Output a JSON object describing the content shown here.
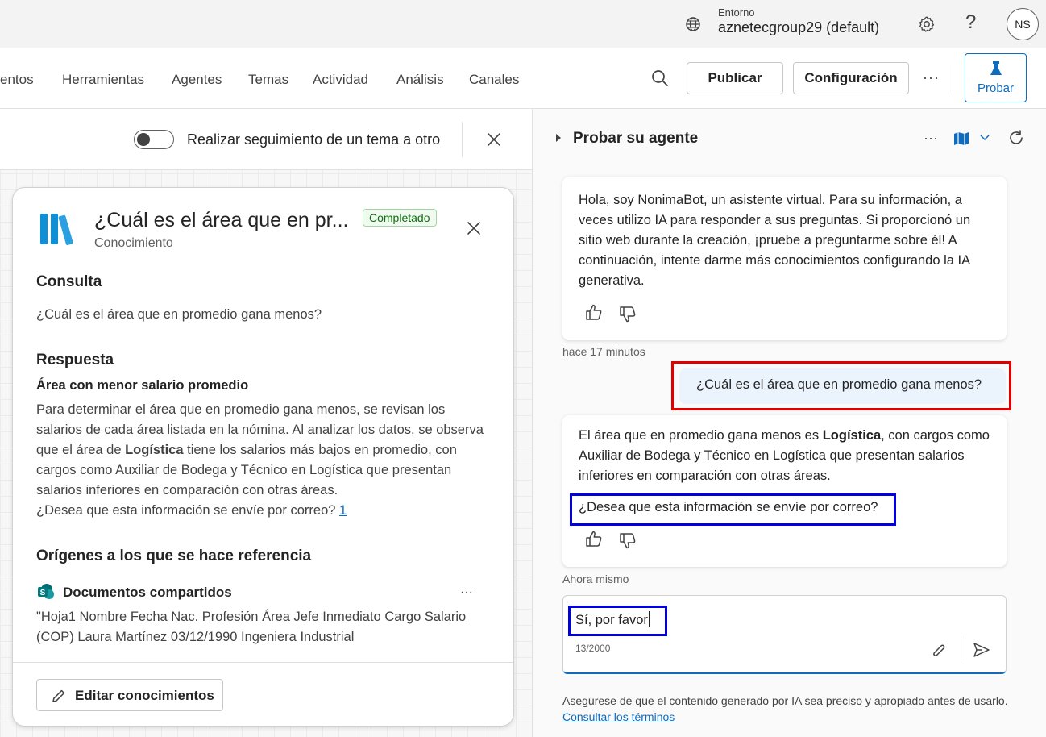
{
  "topbar": {
    "environment_label": "Entorno",
    "environment_value": "aznetecgroup29 (default)",
    "help_glyph": "?",
    "avatar_initials": "NS"
  },
  "nav": {
    "items": [
      "entos",
      "Herramientas",
      "Agentes",
      "Temas",
      "Actividad",
      "Análisis",
      "Canales"
    ],
    "publish_label": "Publicar",
    "config_label": "Configuración",
    "more_label": "···",
    "test_label": "Probar"
  },
  "topic_panel": {
    "toggle_label": "Realizar seguimiento de un tema a otro",
    "toggle_on": false
  },
  "card": {
    "title": "¿Cuál es el área que en pr...",
    "subtitle": "Conocimiento",
    "status_badge": "Completado",
    "query_heading": "Consulta",
    "query_text": "¿Cuál es el área que en promedio gana menos?",
    "answer_heading": "Respuesta",
    "answer_subheading": "Área con menor salario promedio",
    "answer_p1": "Para determinar el área que en promedio gana menos, se revisan los salarios de cada área listada en la nómina. Al analizar los datos, se observa que el área de ",
    "answer_bold": "Logística",
    "answer_p2": " tiene los salarios más bajos en promedio, con cargos como Auxiliar de Bodega y Técnico en Logística que presentan salarios inferiores en comparación con otras áreas.",
    "answer_p3": "¿Desea que esta información se envíe por correo? ",
    "answer_citation": "1",
    "sources_heading": "Orígenes a los que se hace referencia",
    "source_name": "Documentos compartidos",
    "source_more": "···",
    "source_excerpt": "\"Hoja1 Nombre Fecha Nac. Profesión Área Jefe Inmediato Cargo Salario (COP) Laura Martínez 03/12/1990 Ingeniera Industrial",
    "edit_label": "Editar conocimientos"
  },
  "test_panel": {
    "title": "Probar su agente",
    "more_label": "···",
    "messages": {
      "bot_greeting": "Hola, soy NonimaBot, un asistente virtual. Para su información, a veces utilizo IA para responder a sus preguntas. Si proporcionó un sitio web durante la creación, ¡pruebe a preguntarme sobre él! A continuación, intente darme más conocimientos configurando la IA generativa.",
      "bot_greeting_time": "hace 17 minutos",
      "user_question": "¿Cuál es el área que en promedio gana menos?",
      "bot_answer_p1": "El área que en promedio gana menos es ",
      "bot_answer_bold": "Logística",
      "bot_answer_p2": ", con cargos como Auxiliar de Bodega y Técnico en Logística que presentan salarios inferiores en comparación con otras áreas.",
      "bot_answer_followup": "¿Desea que esta información se envíe por correo?",
      "bot_answer_time": "Ahora mismo"
    },
    "input_value": "Sí, por favor",
    "char_counter": "13/2000",
    "disclaimer": "Asegúrese de que el contenido generado por IA sea preciso y apropiado antes de usarlo. ",
    "disclaimer_link": "Consultar los términos"
  },
  "colors": {
    "accent": "#0f6cbd",
    "highlight_red": "#e00000",
    "highlight_blue": "#0000e0",
    "badge_green": "#0e700e"
  }
}
